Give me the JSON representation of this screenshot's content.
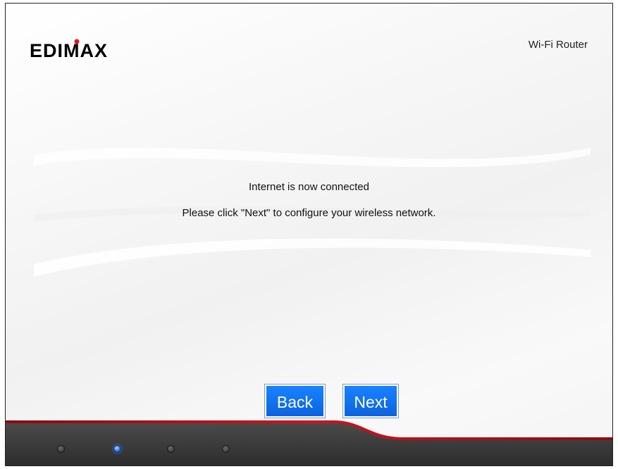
{
  "header": {
    "brand": "EDIMAX",
    "product": "Wi-Fi Router"
  },
  "main": {
    "status_message": "Internet is now connected",
    "instruction": "Please click \"Next\" to configure your wireless network."
  },
  "buttons": {
    "back_label": "Back",
    "next_label": "Next"
  },
  "progress": {
    "total_steps": 4,
    "current_step": 2
  },
  "colors": {
    "button_blue": "#0b63e0",
    "footer_red": "#c1121f",
    "footer_dark": "#3a3a3a",
    "logo_dot_red": "#e3131b"
  }
}
